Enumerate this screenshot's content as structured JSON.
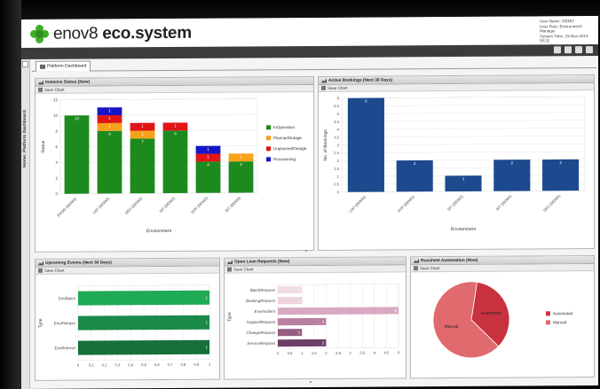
{
  "app": {
    "logo_text_a": "enov",
    "logo_text_b": "8",
    "logo_text_c": " eco.system",
    "user_lines": [
      "User Name: DEMO",
      "User Role: Environment Manager",
      "System Time: 19-Nov-2014 08:32",
      "Local Time: 19-Nov-2014 09:32"
    ]
  },
  "sidebar": {
    "label": "Home: Platform Dashboard"
  },
  "tabs": [
    {
      "label": "Platform Dashboard"
    }
  ],
  "save_label": "Save Chart",
  "colors": {
    "green": "#1c8a1c",
    "orange": "#f7a21b",
    "red": "#e01515",
    "blue": "#1515c8",
    "navy": "#1d4a8e"
  },
  "panels": {
    "instance_status": {
      "title": "Instance Status (Now)"
    },
    "active_bookings": {
      "title": "Active Bookings (Next 30 Days)"
    },
    "upcoming_events": {
      "title": "Upcoming Events (Next 30 Days)"
    },
    "lean_requests": {
      "title": "Open Lean Requests (Now)"
    },
    "runsheet": {
      "title": "Runsheet Automation (Now)"
    }
  },
  "chart_data": [
    {
      "id": "instance_status",
      "type": "bar",
      "stacked": true,
      "categories": [
        "PROD (DEMO)",
        "UAT (DEMO)",
        "DEV (DEMO)",
        "SIT (DEMO)",
        "SVP (DEMO)",
        "SIT (DEMO)"
      ],
      "series": [
        {
          "name": "InOperation",
          "color": "#1c8a1c",
          "values": [
            10,
            8,
            7,
            8,
            4,
            4
          ]
        },
        {
          "name": "PlannedOutage",
          "color": "#f7a21b",
          "values": [
            0,
            1,
            1,
            0,
            0,
            1
          ]
        },
        {
          "name": "UnplannedOutage",
          "color": "#e01515",
          "values": [
            0,
            1,
            1,
            1,
            1,
            0
          ]
        },
        {
          "name": "Provisioning",
          "color": "#1515c8",
          "values": [
            0,
            1,
            0,
            0,
            1,
            0
          ]
        }
      ],
      "xlabel": "Environment",
      "ylabel": "Status",
      "ylim": [
        0,
        12
      ],
      "yticks": [
        0,
        2,
        4,
        6,
        8,
        10,
        12
      ],
      "legend": "right"
    },
    {
      "id": "active_bookings",
      "type": "bar",
      "categories": [
        "UAT (DEMO)",
        "SVP (DEMO)",
        "SIT (DEMO)",
        "SIT (DEMO)",
        "DEV (DEMO)"
      ],
      "values": [
        6,
        2,
        1,
        2,
        2
      ],
      "color": "#1d4a8e",
      "xlabel": "Environment",
      "ylabel": "No. of Bookings",
      "ylim": [
        0,
        6
      ],
      "yticks": [
        0,
        0.5,
        1,
        1.5,
        2,
        2.5,
        3,
        3.5,
        4,
        4.5,
        5,
        5.5,
        6
      ]
    },
    {
      "id": "upcoming_events",
      "type": "bar",
      "orientation": "horizontal",
      "categories": [
        "EnvBatch",
        "EnvRelease",
        "EnvRefresh"
      ],
      "values": [
        1,
        1,
        1
      ],
      "colors": [
        "#1faa55",
        "#1b8a48",
        "#15703a"
      ],
      "ylabel": "Type",
      "xlim": [
        0,
        1
      ],
      "xticks": [
        0,
        0.1,
        0.2,
        0.3,
        0.4,
        0.5,
        0.6,
        0.7,
        0.8,
        0.9,
        1
      ]
    },
    {
      "id": "lean_requests",
      "type": "bar",
      "orientation": "horizontal",
      "categories": [
        "BatchRequest",
        "BookingRequest",
        "EnvIncident",
        "SupportRequest",
        "ChangeRequest",
        "ServiceRequest"
      ],
      "values": [
        1,
        1,
        5,
        2,
        1,
        2
      ],
      "colors": [
        "#f2dde6",
        "#ecd3de",
        "#d9a9c1",
        "#b97fa2",
        "#955c84",
        "#6e3f66"
      ],
      "ylabel": "Type",
      "xlim": [
        0,
        5
      ],
      "xticks": [
        0,
        0.5,
        1,
        1.5,
        2,
        2.5,
        3,
        3.5,
        4,
        4.5,
        5
      ]
    },
    {
      "id": "runsheet",
      "type": "pie",
      "slices": [
        {
          "name": "Automated",
          "value": 35,
          "color": "#c8323f"
        },
        {
          "name": "Manual",
          "value": 65,
          "color": "#e06a6e"
        }
      ],
      "legend": "right"
    }
  ]
}
